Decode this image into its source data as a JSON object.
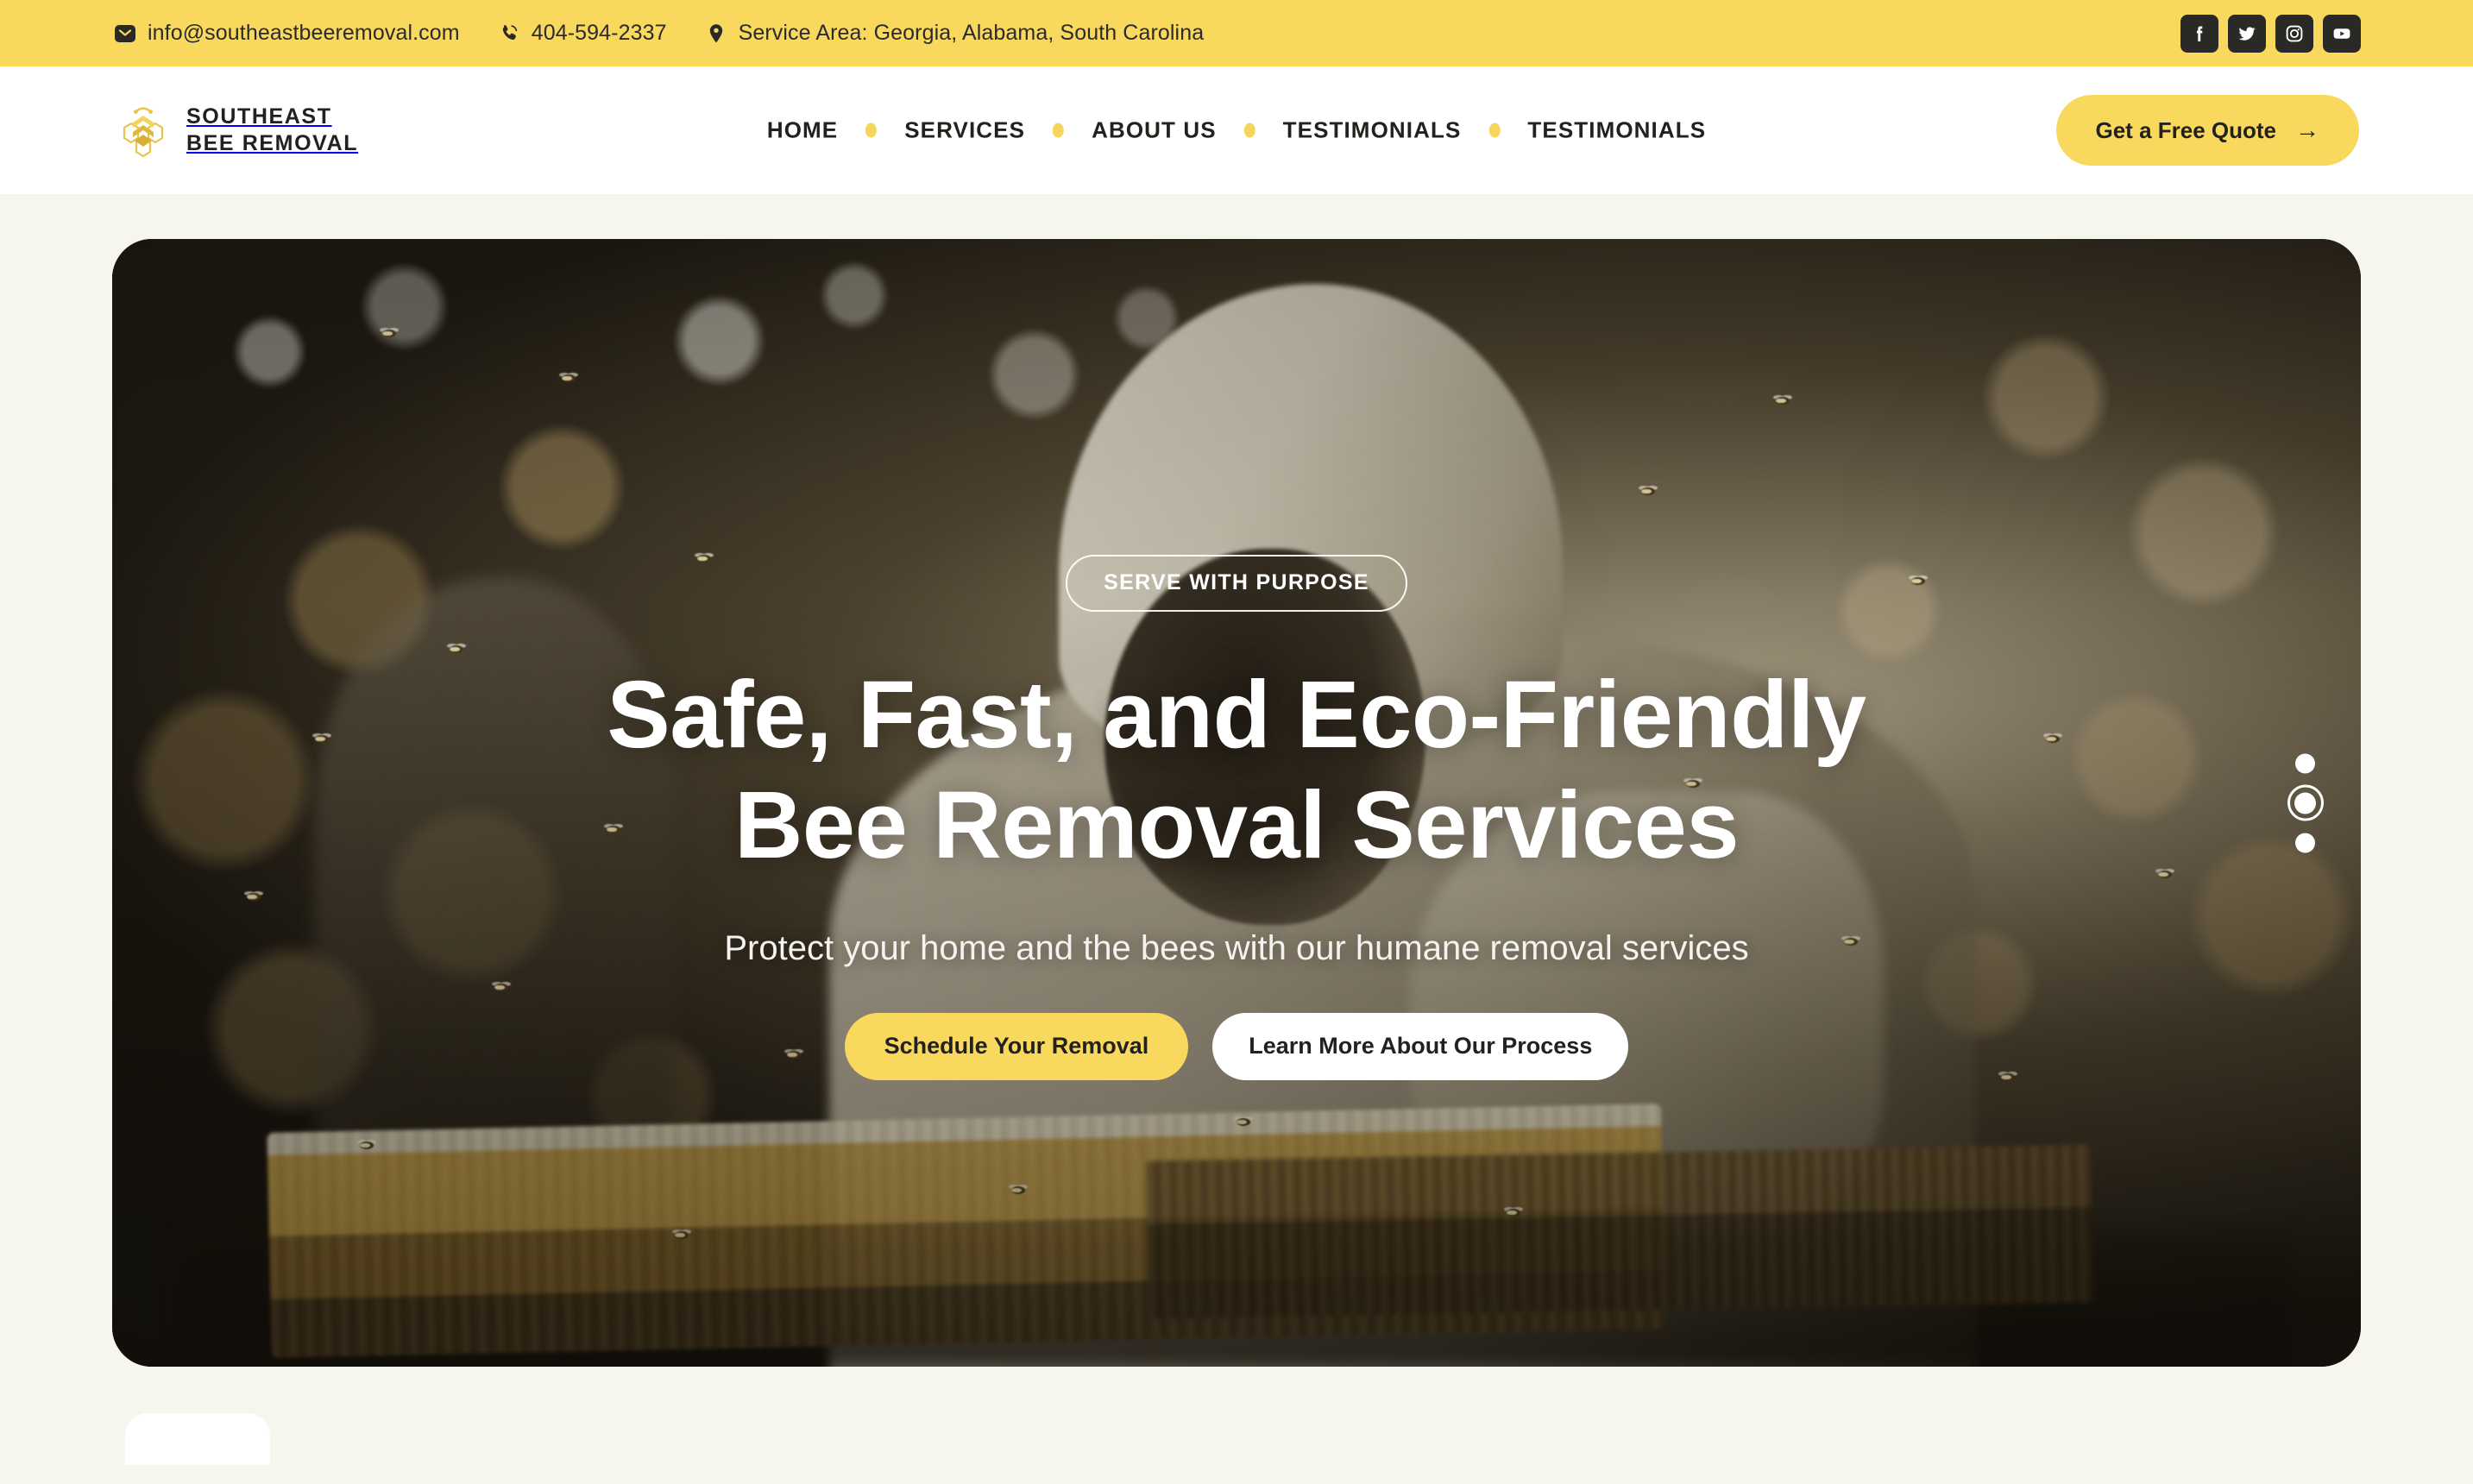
{
  "topbar": {
    "background": "#F9D85E",
    "contacts": [
      {
        "icon": "mail-icon",
        "text": "info@southeastbeeremoval.com"
      },
      {
        "icon": "phone-icon",
        "text": "404-594-2337"
      },
      {
        "icon": "location-pin-icon",
        "text": "Service Area: Georgia, Alabama, South Carolina"
      }
    ],
    "socials": [
      {
        "icon": "facebook-icon",
        "label": "Facebook"
      },
      {
        "icon": "twitter-icon",
        "label": "Twitter"
      },
      {
        "icon": "instagram-icon",
        "label": "Instagram"
      },
      {
        "icon": "youtube-icon",
        "label": "YouTube"
      }
    ]
  },
  "brand": {
    "line1": "SOUTHEAST",
    "line2": "BEE REMOVAL",
    "logo_icon": "hexagon-bee-logo-icon",
    "logo_color": "#E8C44A"
  },
  "nav": {
    "items": [
      {
        "label": "HOME"
      },
      {
        "label": "SERVICES"
      },
      {
        "label": "ABOUT US"
      },
      {
        "label": "TESTIMONIALS"
      },
      {
        "label": "TESTIMONIALS"
      }
    ],
    "separator_color": "#F6D65A",
    "cta": {
      "label": "Get a Free Quote",
      "arrow": "→",
      "color": "#F9D85E"
    }
  },
  "hero": {
    "badge": "SERVE WITH PURPOSE",
    "title_line1": "Safe, Fast, and Eco-Friendly",
    "title_line2": "Bee Removal Services",
    "subtitle": "Protect your home and the bees with our humane removal services",
    "primary_button": "Schedule Your Removal",
    "secondary_button": "Learn More About Our Process",
    "carousel": {
      "total": 3,
      "active_index": 1
    },
    "image_description": "Beekeeper in white protective suit with veil hood tending honeycomb frames surrounded by flying bees, dark golden bokeh background"
  },
  "colors": {
    "accent_yellow": "#F9D85E",
    "dark": "#23211E",
    "page_background": "#F7F6EE",
    "nav_background": "#FFFFFF"
  }
}
